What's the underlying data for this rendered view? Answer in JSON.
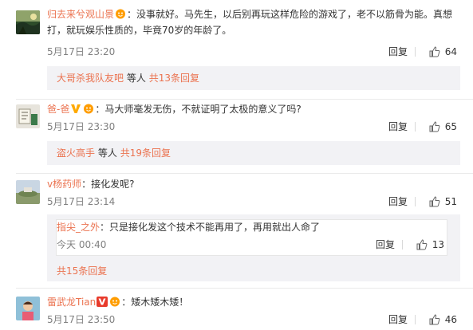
{
  "comments": [
    {
      "username": "归去来兮观山景",
      "text": "：没事就好。马先生，以后别再玩这样危险的游戏了，老不以筋骨为能。真想打，就玩娱乐性质的，毕竟70岁的年龄了。",
      "time": "5月17日 23:20",
      "reply_label": "回复",
      "likes": "64",
      "sub_user": "大哥杀我队友吧",
      "sub_middle": "等人",
      "sub_count": "共13条回复"
    },
    {
      "username": "爸-爸",
      "text": "：马大师毫发无伤，不就证明了太极的意义了吗?",
      "time": "5月17日 23:30",
      "reply_label": "回复",
      "likes": "65",
      "sub_user": "盗火高手",
      "sub_middle": "等人",
      "sub_count": "共19条回复"
    },
    {
      "username": "v杨药师",
      "text": "：接化发呢?",
      "time": "5月17日 23:14",
      "reply_label": "回复",
      "likes": "51",
      "nested": {
        "username": "指尖_之外",
        "text": "：只是接化发这个技术不能再用了，再用就出人命了",
        "time": "今天 00:40",
        "reply_label": "回复",
        "likes": "13"
      },
      "more_replies": "共15条回复"
    },
    {
      "username": "雷武龙Tian",
      "text": "：矮木矮木矮！",
      "time": "5月17日 23:50",
      "reply_label": "回复",
      "likes": "46"
    }
  ],
  "colors": {
    "link": "#eb7350",
    "meta": "#808080",
    "subbg": "#f2f2f5",
    "vbadge": "#ff8200"
  },
  "icons": [
    "thumbs-up-icon",
    "vip-face-badge-icon",
    "verified-v-badge-icon"
  ]
}
